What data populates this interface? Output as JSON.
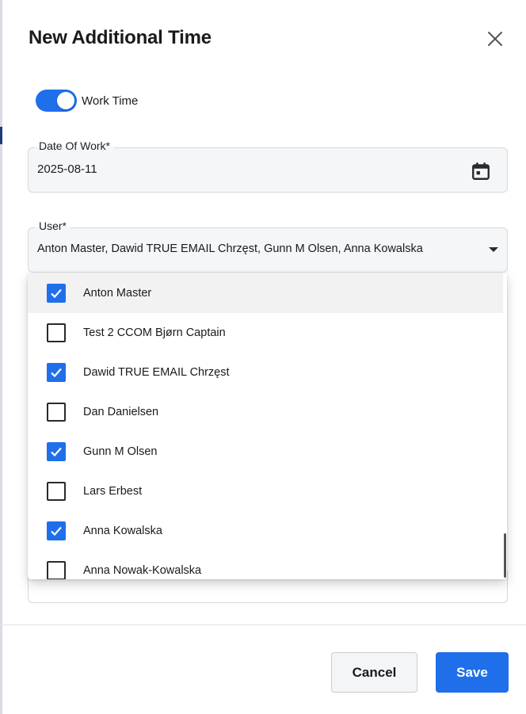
{
  "dialog": {
    "title": "New Additional Time"
  },
  "work_time_toggle": {
    "label": "Work Time",
    "on": true
  },
  "date_field": {
    "label": "Date Of Work*",
    "value": "2025-08-11"
  },
  "user_field": {
    "label": "User*",
    "value": "Anton Master, Dawid TRUE EMAIL Chrzęst, Gunn M Olsen, Anna Kowalska"
  },
  "user_options": [
    {
      "label": "Anton Master",
      "checked": true
    },
    {
      "label": "Test 2 CCOM Bjørn Captain",
      "checked": false
    },
    {
      "label": "Dawid TRUE EMAIL Chrzęst",
      "checked": true
    },
    {
      "label": "Dan Danielsen",
      "checked": false
    },
    {
      "label": "Gunn M Olsen",
      "checked": true
    },
    {
      "label": "Lars Erbest",
      "checked": false
    },
    {
      "label": "Anna Kowalska",
      "checked": true
    },
    {
      "label": "Anna Nowak-Kowalska",
      "checked": false
    }
  ],
  "footer": {
    "cancel_label": "Cancel",
    "save_label": "Save"
  },
  "colors": {
    "accent": "#1f6fea",
    "field_bg": "#f5f6f8"
  },
  "icons": {
    "close": "close-icon",
    "calendar": "calendar-icon",
    "dropdown": "chevron-down-icon",
    "check": "check-icon"
  }
}
